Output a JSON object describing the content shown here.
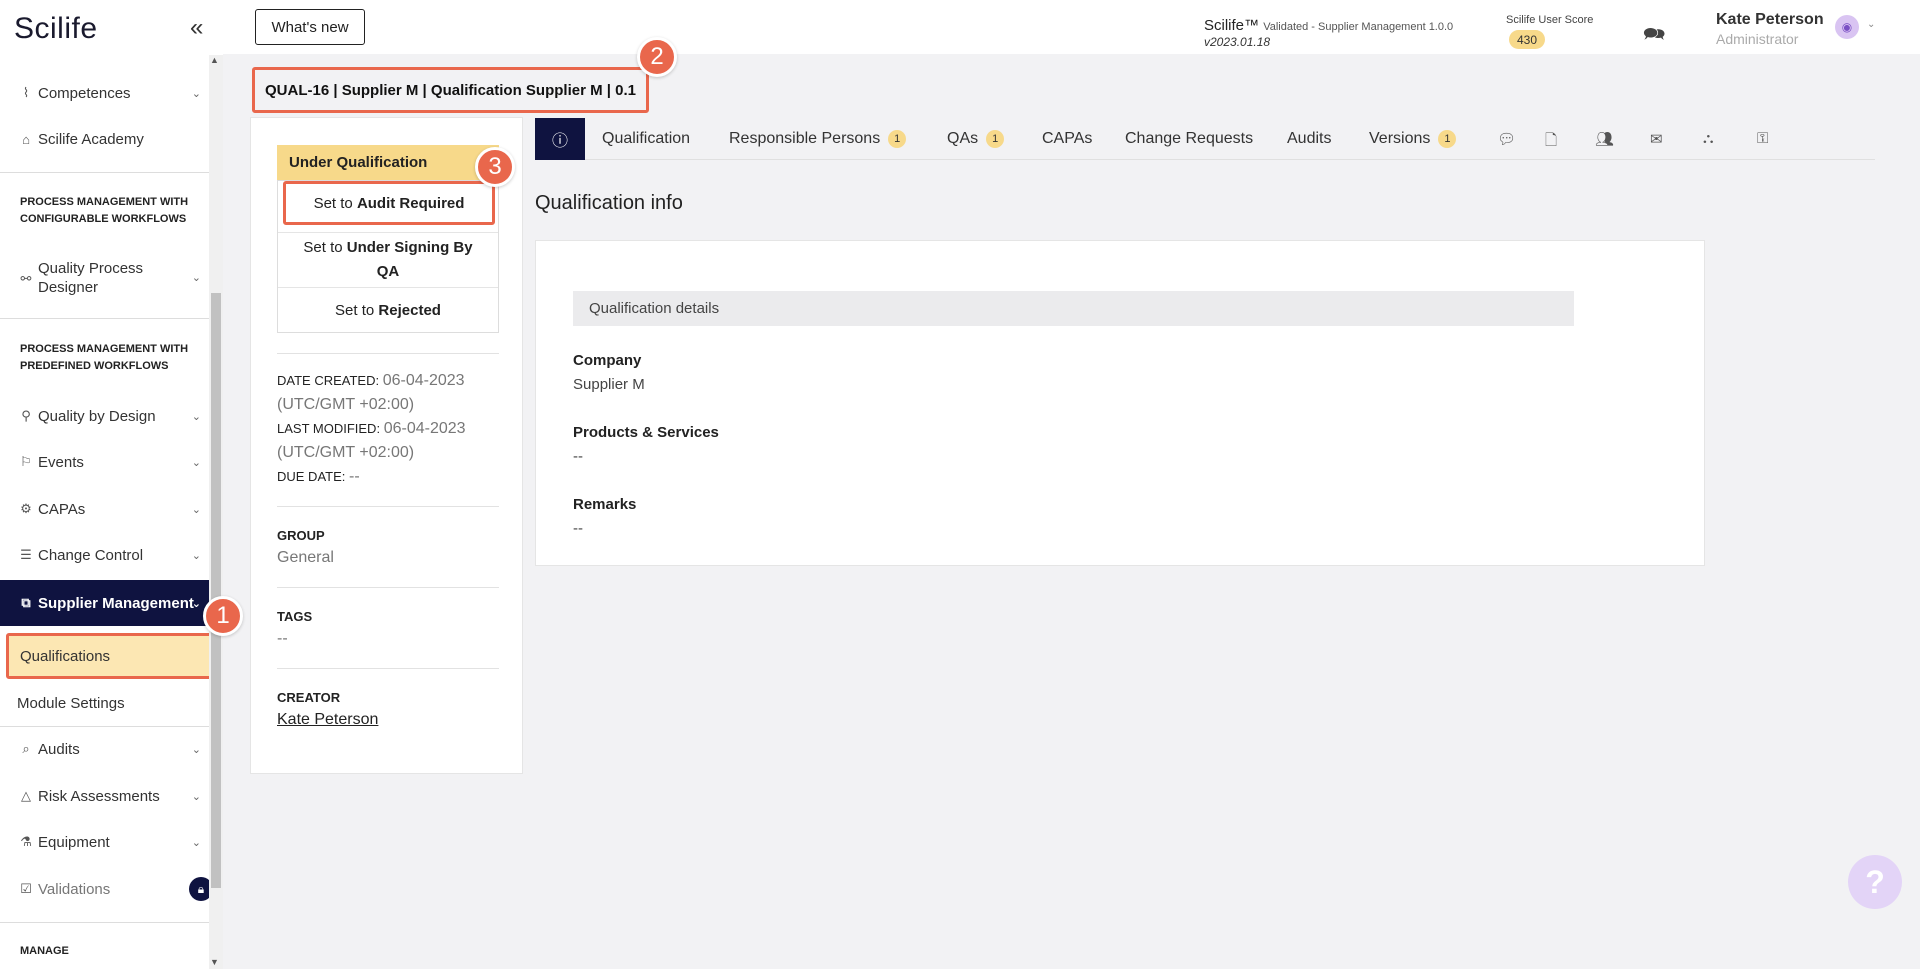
{
  "sidebar": {
    "brand": "Scilife",
    "collapse_icon": "«",
    "items": [
      {
        "label": "Competences",
        "icon": "competences-icon"
      },
      {
        "label": "Scilife Academy",
        "icon": "academy-icon"
      }
    ],
    "section_configurable": "PROCESS MANAGEMENT WITH CONFIGURABLE WORKFLOWS",
    "quality_process_designer": "Quality Process Designer",
    "section_predefined": "PROCESS MANAGEMENT WITH PREDEFINED WORKFLOWS",
    "quality_by_design": "Quality by Design",
    "events": "Events",
    "capas": "CAPAs",
    "change_control": "Change Control",
    "supplier_management": "Supplier Management",
    "qualifications": "Qualifications",
    "module_settings": "Module Settings",
    "audits": "Audits",
    "risk_assessments": "Risk Assessments",
    "equipment": "Equipment",
    "validations": "Validations",
    "section_manage": "MANAGE"
  },
  "topbar": {
    "whats_new": "What's new",
    "product": "Scilife™",
    "product_sub": "Validated - Supplier Management 1.0.0",
    "version": "v2023.01.18",
    "score_label": "Scilife User Score",
    "score_value": "430",
    "user_name": "Kate Peterson",
    "user_role": "Administrator"
  },
  "steps": {
    "one": "1",
    "two": "2",
    "three": "3"
  },
  "record": {
    "title": "QUAL-16 | Supplier M | Qualification Supplier M | 0.1"
  },
  "status": {
    "current": "Under Qualification",
    "set_to": "Set to",
    "opt1": "Audit Required",
    "opt2": "Under Signing By QA",
    "opt3": "Rejected"
  },
  "meta": {
    "date_created_label": "DATE CREATED:",
    "date_created": "06-04-2023 (UTC/GMT +02:00)",
    "last_modified_label": "LAST MODIFIED:",
    "last_modified": "06-04-2023 (UTC/GMT +02:00)",
    "due_date_label": "DUE DATE:",
    "due_date": "--",
    "group_label": "GROUP",
    "group": "General",
    "tags_label": "TAGS",
    "tags": "--",
    "creator_label": "CREATOR",
    "creator": "Kate Peterson"
  },
  "tabs": {
    "info_icon": "ⓘ",
    "qualification": "Qualification",
    "responsible_persons": "Responsible Persons",
    "responsible_persons_count": "1",
    "qas": "QAs",
    "qas_count": "1",
    "capas": "CAPAs",
    "change_requests": "Change Requests",
    "audits": "Audits",
    "versions": "Versions",
    "versions_count": "1"
  },
  "content": {
    "section_title": "Qualification info",
    "details_head": "Qualification details",
    "company_label": "Company",
    "company": "Supplier M",
    "products_label": "Products & Services",
    "products": "--",
    "remarks_label": "Remarks",
    "remarks": "--"
  },
  "help": "?"
}
